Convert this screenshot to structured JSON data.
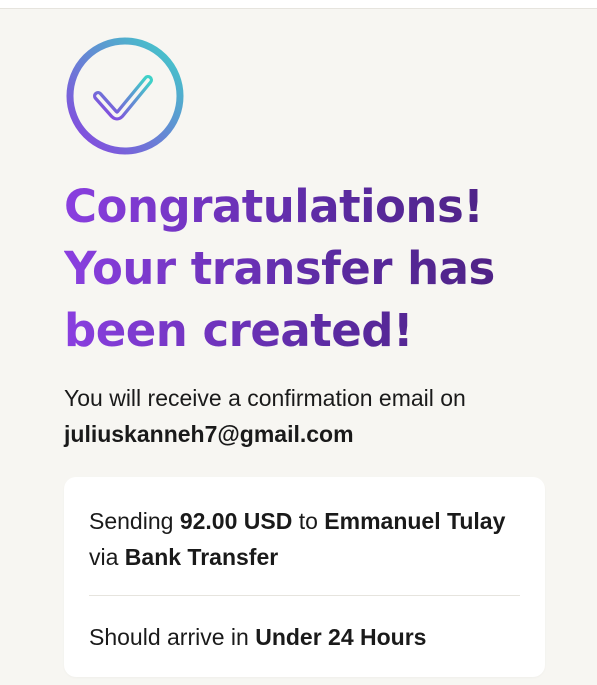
{
  "icons": {
    "badge": "check-circle-icon"
  },
  "colors": {
    "background": "#f7f6f2",
    "headline_start": "#8a3fe0",
    "headline_end": "#4a1f7a",
    "badge_ring_start": "#8a3fe0",
    "badge_ring_end": "#3fd1c8"
  },
  "headline": {
    "line1": "Congratulations!",
    "line2": "Your transfer has",
    "line3": "been created!"
  },
  "confirmation": {
    "text": "You will receive a confirmation email on",
    "email": "juliuskanneh7@gmail.com"
  },
  "summary": {
    "sending_prefix": "Sending",
    "amount": "92.00 USD",
    "to_word": "to",
    "recipient": "Emmanuel Tulay",
    "via_word": "via",
    "method": "Bank Transfer",
    "arrival_prefix": "Should arrive in",
    "arrival_time": "Under 24 Hours"
  }
}
